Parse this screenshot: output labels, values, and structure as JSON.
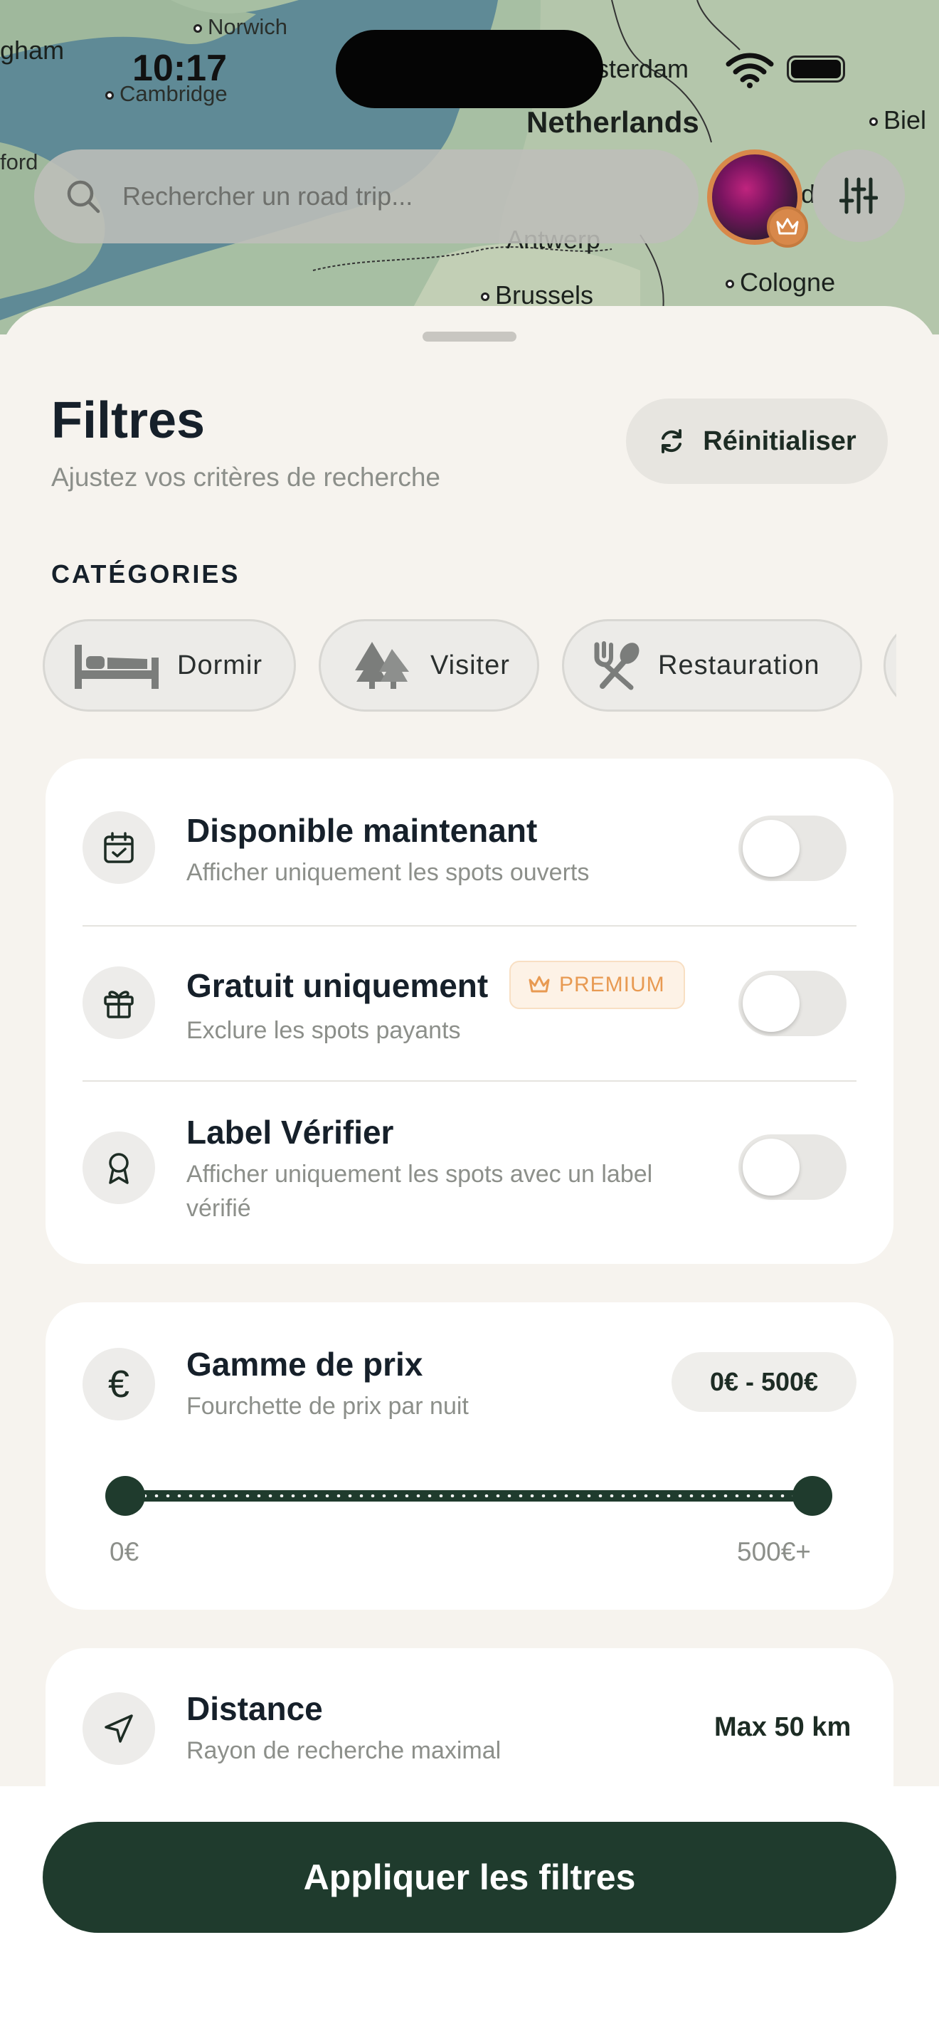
{
  "status_bar": {
    "time": "10:17"
  },
  "map": {
    "labels": [
      "Norwich",
      "gham",
      "Cambridge",
      "sterdam",
      "Netherlands",
      "Biel",
      "ford",
      "Antwerp",
      "d",
      "Brussels",
      "Cologne"
    ]
  },
  "search": {
    "placeholder": "Rechercher un road trip..."
  },
  "sheet": {
    "title": "Filtres",
    "subtitle": "Ajustez vos critères de recherche",
    "reset_label": "Réinitialiser"
  },
  "categories": {
    "label": "CATÉGORIES",
    "items": [
      {
        "label": "Dormir",
        "icon": "bed-icon"
      },
      {
        "label": "Visiter",
        "icon": "trees-icon"
      },
      {
        "label": "Restauration",
        "icon": "utensils-icon"
      }
    ]
  },
  "toggles": [
    {
      "title": "Disponible maintenant",
      "subtitle": "Afficher uniquement les spots ouverts",
      "on": false,
      "icon": "calendar-check-icon"
    },
    {
      "title": "Gratuit uniquement",
      "subtitle": "Exclure les spots payants",
      "on": false,
      "icon": "gift-icon",
      "badge": "PREMIUM"
    },
    {
      "title": "Label Vérifier",
      "subtitle": "Afficher uniquement les spots avec un label vérifié",
      "on": false,
      "icon": "award-icon"
    }
  ],
  "price": {
    "title": "Gamme de prix",
    "subtitle": "Fourchette de prix par nuit",
    "range": "0€ - 500€",
    "min_label": "0€",
    "max_label": "500€+",
    "min_value": 0,
    "max_value": 500
  },
  "distance": {
    "title": "Distance",
    "subtitle": "Rayon de recherche maximal",
    "value": "Max 50 km"
  },
  "apply_label": "Appliquer les filtres",
  "colors": {
    "primary": "#1f3b2d",
    "premium": "#e89a52",
    "background": "#f6f3ee"
  }
}
